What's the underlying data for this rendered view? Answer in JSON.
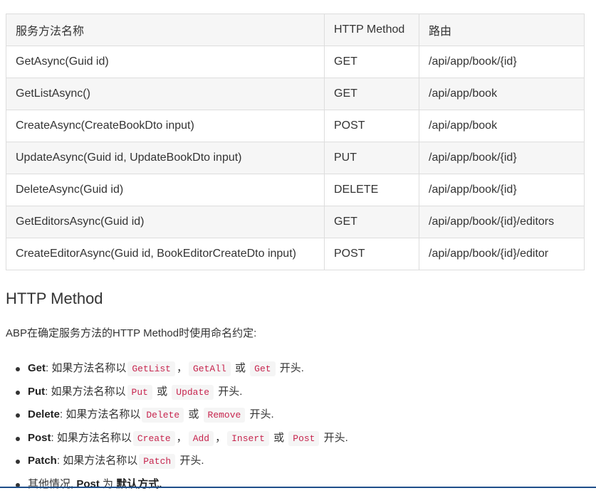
{
  "table": {
    "headers": [
      "服务方法名称",
      "HTTP Method",
      "路由"
    ],
    "rows": [
      [
        "GetAsync(Guid id)",
        "GET",
        "/api/app/book/{id}"
      ],
      [
        "GetListAsync()",
        "GET",
        "/api/app/book"
      ],
      [
        "CreateAsync(CreateBookDto input)",
        "POST",
        "/api/app/book"
      ],
      [
        "UpdateAsync(Guid id, UpdateBookDto input)",
        "PUT",
        "/api/app/book/{id}"
      ],
      [
        "DeleteAsync(Guid id)",
        "DELETE",
        "/api/app/book/{id}"
      ],
      [
        "GetEditorsAsync(Guid id)",
        "GET",
        "/api/app/book/{id}/editors"
      ],
      [
        "CreateEditorAsync(Guid id, BookEditorCreateDto input)",
        "POST",
        "/api/app/book/{id}/editor"
      ]
    ]
  },
  "section": {
    "title": "HTTP Method",
    "intro": "ABP在确定服务方法的HTTP Method时使用命名约定:"
  },
  "rules": [
    {
      "method": "Get",
      "prefix": ": 如果方法名称以",
      "codes": [
        "GetList",
        "GetAll",
        "Get"
      ],
      "seps": [
        "，",
        " 或 "
      ],
      "suffix": " 开头."
    },
    {
      "method": "Put",
      "prefix": ": 如果方法名称以",
      "codes": [
        "Put",
        "Update"
      ],
      "seps": [
        " 或 "
      ],
      "suffix": " 开头."
    },
    {
      "method": "Delete",
      "prefix": ": 如果方法名称以",
      "codes": [
        "Delete",
        "Remove"
      ],
      "seps": [
        " 或 "
      ],
      "suffix": " 开头."
    },
    {
      "method": "Post",
      "prefix": ": 如果方法名称以",
      "codes": [
        "Create",
        "Add",
        "Insert",
        "Post"
      ],
      "seps": [
        "，",
        "，",
        " 或 "
      ],
      "suffix": " 开头."
    },
    {
      "method": "Patch",
      "prefix": ": 如果方法名称以",
      "codes": [
        "Patch"
      ],
      "seps": [],
      "suffix": " 开头."
    }
  ],
  "default_rule": {
    "lead": "其他情况, ",
    "method": "Post",
    "mid": " 为 ",
    "tail": "默认方式."
  }
}
